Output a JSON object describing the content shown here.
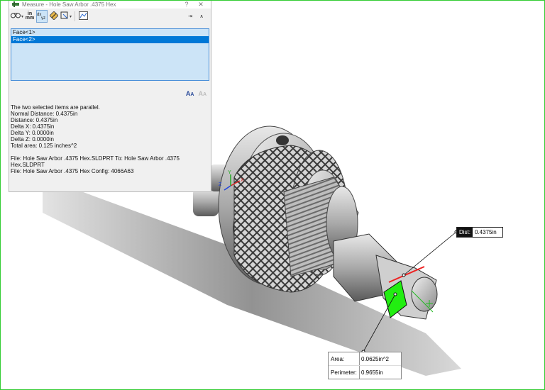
{
  "window": {
    "title": "Measure - Hole Saw Arbor .4375 Hex",
    "help_label": "?",
    "close_label": "✕"
  },
  "toolbar": {
    "units_top": "in",
    "units_bottom": "mm",
    "pin_label": "⇥",
    "collapse_label": "∧"
  },
  "selections": [
    {
      "label": "Face<1>",
      "selected": false
    },
    {
      "label": "Face<2>",
      "selected": true
    }
  ],
  "results": {
    "parallel": "The two selected items are parallel.",
    "normal_distance": "Normal Distance: 0.4375in",
    "distance": "Distance: 0.4375in",
    "delta_x": "Delta X: 0.4375in",
    "delta_y": "Delta Y: 0.0000in",
    "delta_z": "Delta Z: 0.0000in",
    "total_area": "Total area: 0.125 inches^2",
    "file_line1": "File: Hole Saw Arbor .4375 Hex.SLDPRT To: Hole Saw Arbor .4375",
    "file_line2": "Hex.SLDPRT",
    "file_line3": "File: Hole Saw Arbor .4375 Hex Config: 4066A63"
  },
  "callouts": {
    "dist_label": "Dist:",
    "dist_value": "0.4375in",
    "area_label": "Area:",
    "area_value": "0.0625in^2",
    "perimeter_label": "Perimeter:",
    "perimeter_value": "0.9655in"
  },
  "triad": {
    "x": "X",
    "y": "Y",
    "z": "Z"
  },
  "colors": {
    "accent": "#0078d7",
    "list_bg": "#cce4f7",
    "selected_face": "#22ee11",
    "measure_line": "#ee2222",
    "frame": "#33cc33"
  },
  "icons": [
    "measure-app-icon",
    "arc-mode-icon",
    "units-icon",
    "xyz-delta-icon",
    "point-to-point-icon",
    "projection-icon",
    "history-icon",
    "pin-icon",
    "collapse-icon",
    "font-increase-icon",
    "font-decrease-icon"
  ]
}
